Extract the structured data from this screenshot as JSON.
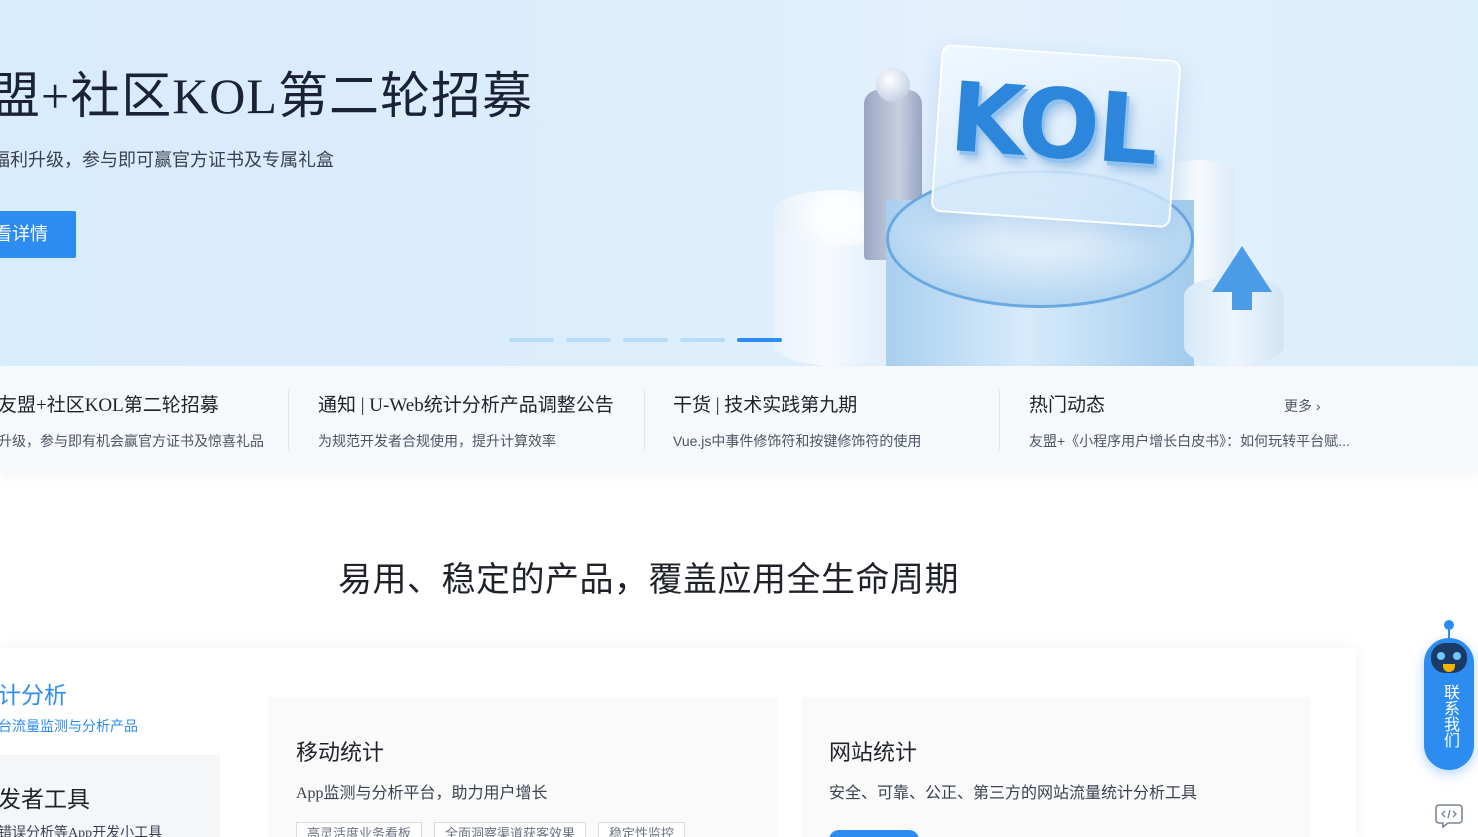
{
  "hero": {
    "title": "盟+社区KOL第二轮招募",
    "subtitle": "福利升级，参与即可赢官方证书及专属礼盒",
    "button_label": "看详情",
    "illustration_text": "KOL",
    "slide_count": 5,
    "active_slide": 5
  },
  "news": {
    "items": [
      {
        "title": "友盟+社区KOL第二轮招募",
        "desc": "升级，参与即有机会赢官方证书及惊喜礼品"
      },
      {
        "title": "通知 | U-Web统计分析产品调整公告",
        "desc": "为规范开发者合规使用，提升计算效率"
      },
      {
        "title": "干货 | 技术实践第九期",
        "desc": "Vue.js中事件修饰符和按键修饰符的使用"
      },
      {
        "title": "热门动态",
        "desc": "友盟+《小程序用户增长白皮书》：如何玩转平台赋..."
      }
    ],
    "more_label": "更多 ›"
  },
  "section": {
    "title": "易用、稳定的产品，覆盖应用全生命周期"
  },
  "sidebar": {
    "items": [
      {
        "title": "计分析",
        "desc": "台流量监测与分析产品",
        "active": true
      },
      {
        "title": "发者工具",
        "desc": "错误分析等App开发小工具",
        "active": false
      }
    ]
  },
  "cards": [
    {
      "title": "移动统计",
      "desc": "App监测与分析平台，助力用户增长",
      "tags": [
        "高灵活度业务看板",
        "全面洞察渠道获客效果",
        "稳定性监控"
      ]
    },
    {
      "title": "网站统计",
      "desc": "安全、可靠、公正、第三方的网站流量统计分析工具",
      "tags": []
    }
  ],
  "float_widget": {
    "label": "联系我们"
  },
  "colors": {
    "accent": "#2d8cf0",
    "hero_bg": "#dcedfc",
    "news_bg": "#f6f9fc"
  }
}
